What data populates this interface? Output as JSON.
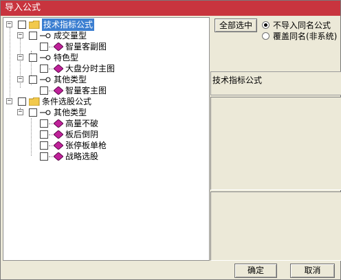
{
  "window": {
    "title": "导入公式"
  },
  "tree": {
    "root1": {
      "label": "技术指标公式"
    },
    "g1": {
      "label": "成交量型"
    },
    "g1_i1": {
      "label": "智量客副图"
    },
    "g2": {
      "label": "特色型"
    },
    "g2_i1": {
      "label": "大盘分时主图"
    },
    "g3": {
      "label": "其他类型"
    },
    "g3_i1": {
      "label": "智量客主图"
    },
    "root2": {
      "label": "条件选股公式"
    },
    "g4": {
      "label": "其他类型"
    },
    "g4_i1": {
      "label": "高量不破"
    },
    "g4_i2": {
      "label": "板后倒阴"
    },
    "g4_i3": {
      "label": "张停板单枪"
    },
    "g4_i4": {
      "label": "战略选股"
    }
  },
  "options": {
    "select_all_label": "全部选中",
    "radio1_label": "不导入同名公式",
    "radio2_label": "覆盖同名(非系统)",
    "selected_radio": "radio1"
  },
  "info": {
    "title": "技术指标公式"
  },
  "buttons": {
    "ok_label": "确定",
    "cancel_label": "取消"
  },
  "colors": {
    "titlebar": "#c8343e",
    "selection": "#3c7fd1",
    "folder": "#f2c94c",
    "gem": "#c0219a"
  }
}
